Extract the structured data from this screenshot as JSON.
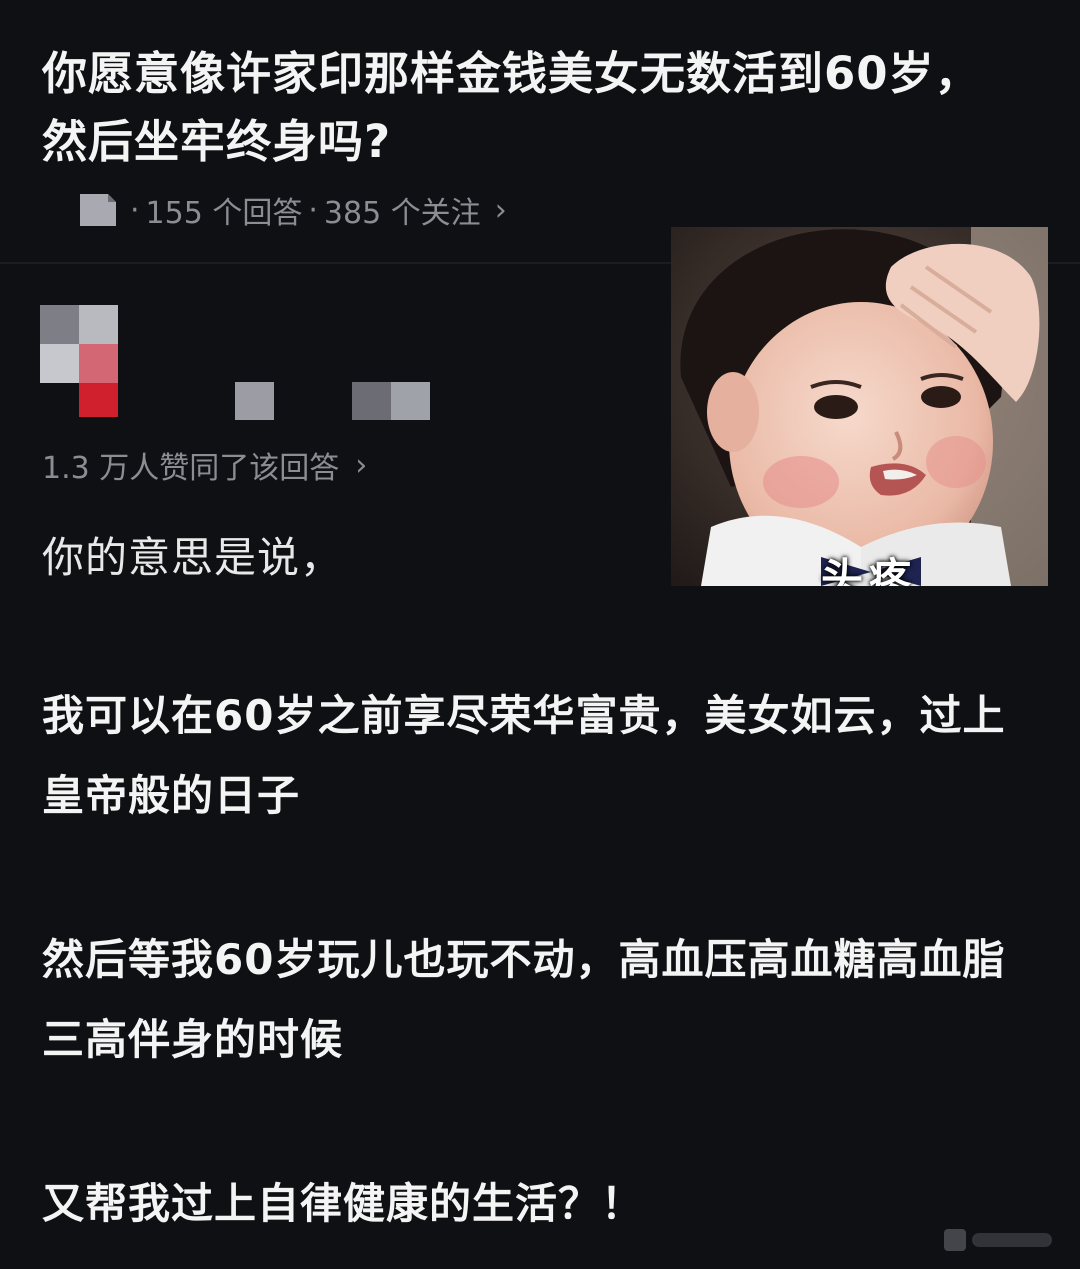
{
  "question": {
    "title": "你愿意像许家印那样金钱美女无数活到60岁，然后坐牢终身吗?",
    "answers_count": "155 个回答",
    "separator": "·",
    "follow_count": "385 个关注",
    "chevron": "›"
  },
  "answer": {
    "upvote_text": "1.3 万人赞同了该回答",
    "chevron": "›",
    "paragraphs": [
      "你的意思是说，",
      "我可以在60岁之前享尽荣华富贵，美女如云，过上皇帝般的日子",
      "然后等我60岁玩儿也玩不动，高血压高血糖高血脂三高伴身的时候",
      "又帮我过上自律健康的生活？！"
    ],
    "image": {
      "caption": "头疼"
    }
  },
  "colors": {
    "background": "#0f1014",
    "text": "#f4f4f4",
    "muted": "#8b8d93",
    "mosaic_red": "#d0202d",
    "mosaic_pink": "#d36874"
  },
  "icons": {
    "meta_icon": "document-icon",
    "avatar": "pixelated-avatar"
  }
}
